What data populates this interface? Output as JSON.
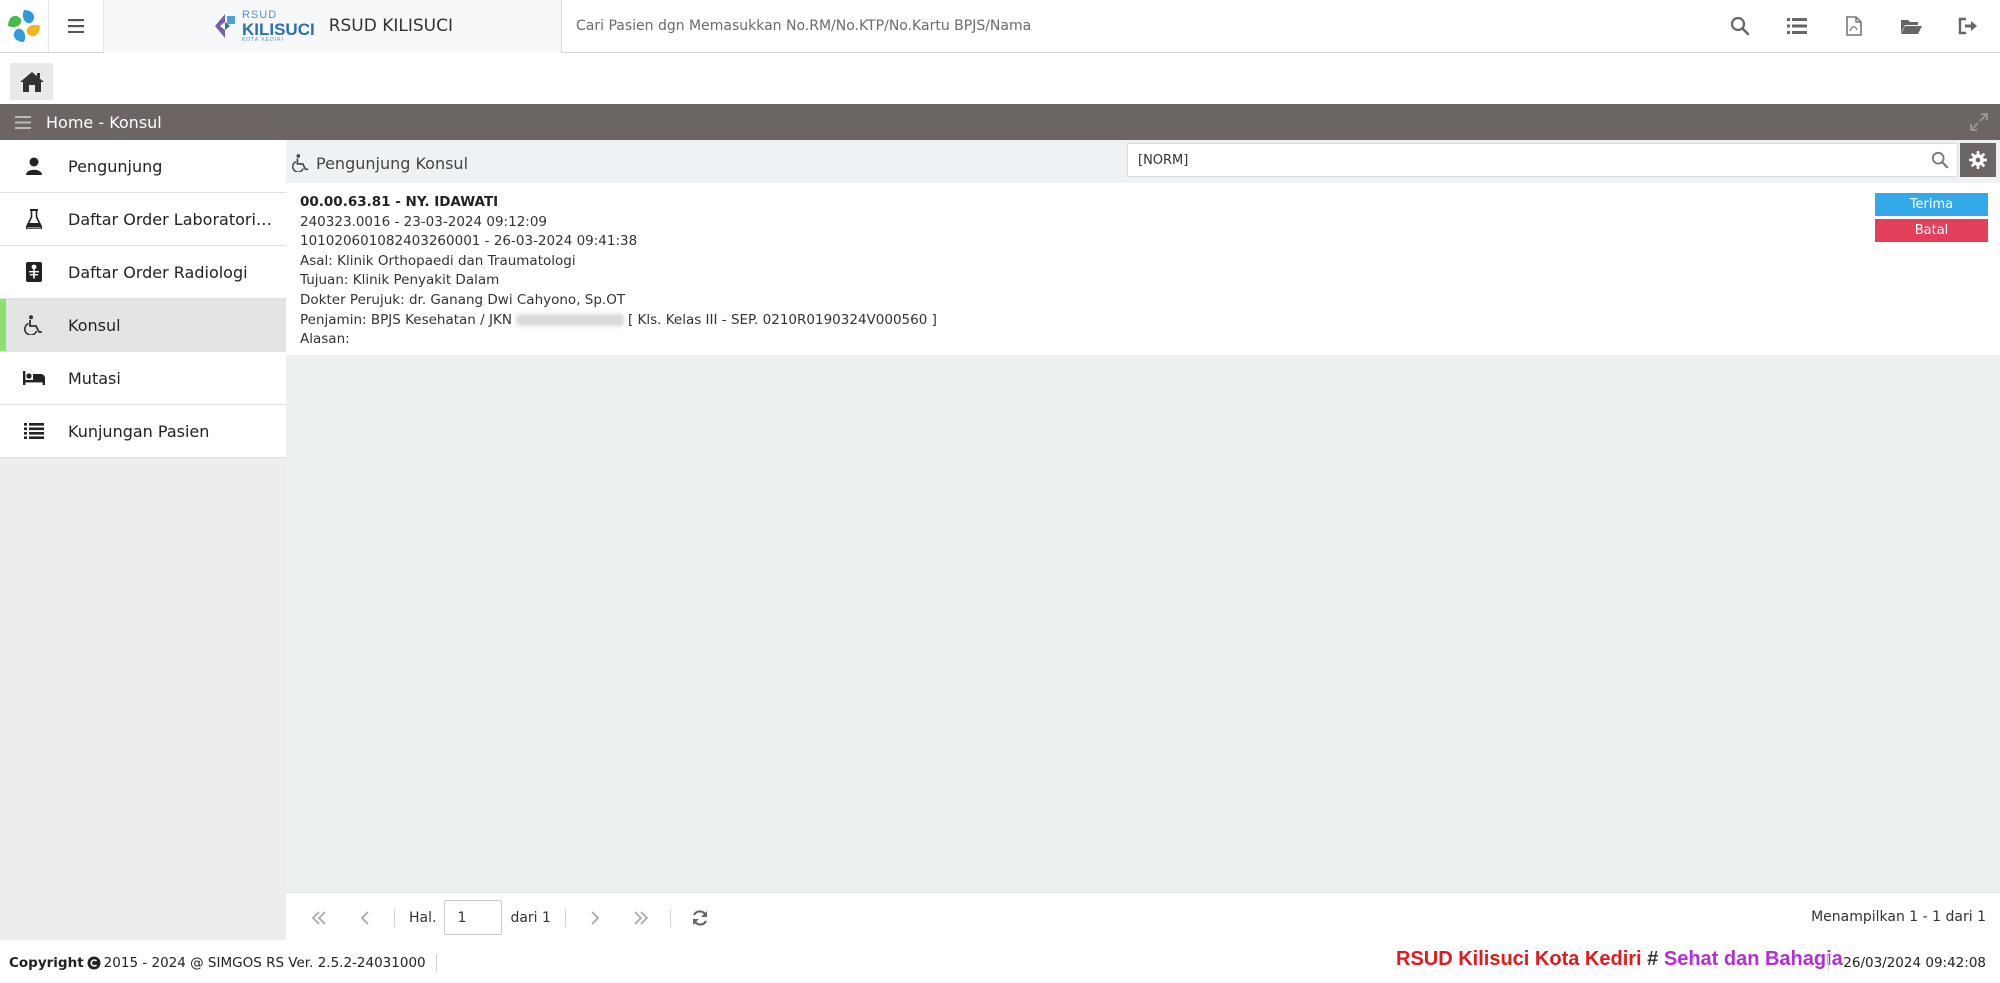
{
  "header": {
    "brand_logo_small": "RSUD",
    "brand_logo_big": "KILISUCI",
    "brand_logo_tiny": "KOTA KEDIRI",
    "brand_name": "RSUD KILISUCI",
    "search_placeholder": "Cari Pasien dgn Memasukkan No.RM/No.KTP/No.Kartu BPJS/Nama",
    "icons": [
      "search-icon",
      "list-icon",
      "pdf-file-icon",
      "folder-open-icon",
      "sign-out-icon"
    ]
  },
  "breadcrumb": {
    "text": "Home - Konsul"
  },
  "sidebar": {
    "items": [
      {
        "label": "Pengunjung",
        "icon": "user-icon",
        "active": false
      },
      {
        "label": "Daftar Order Laboratorium",
        "icon": "flask-icon",
        "active": false
      },
      {
        "label": "Daftar Order Radiologi",
        "icon": "radiology-icon",
        "active": false
      },
      {
        "label": "Konsul",
        "icon": "wheelchair-icon",
        "active": true
      },
      {
        "label": "Mutasi",
        "icon": "bed-icon",
        "active": false
      },
      {
        "label": "Kunjungan Pasien",
        "icon": "list-icon",
        "active": false
      }
    ]
  },
  "panel": {
    "title": "Pengunjung Konsul",
    "search_value": "[NORM]"
  },
  "record": {
    "patient": "00.00.63.81 - NY. IDAWATI",
    "visit": "240323.0016 - 23-03-2024 09:12:09",
    "registration": "101020601082403260001 - 26-03-2024 09:41:38",
    "asal": "Asal: Klinik Orthopaedi dan Traumatologi",
    "tujuan": "Tujuan: Klinik Penyakit Dalam",
    "dokter": "Dokter Perujuk: dr. Ganang Dwi Cahyono, Sp.OT",
    "penjamin_prefix": "Penjamin: BPJS Kesehatan / JKN",
    "penjamin_suffix": "[ Kls. Kelas III - SEP. 0210R0190324V000560 ]",
    "alasan": "Alasan:",
    "btn_terima": "Terima",
    "btn_batal": "Batal"
  },
  "pager": {
    "hal_label": "Hal.",
    "page_value": "1",
    "of_label": "dari 1",
    "info": "Menampilkan 1 - 1 dari 1"
  },
  "footer": {
    "copyright_label": "Copyright",
    "copyright_text": "2015 - 2024 @ SIMGOS RS Ver. 2.5.2-24031000",
    "marquee_red": "RSUD Kilisuci Kota Kediri",
    "marquee_hash": "#",
    "marquee_purple": "Sehat dan Bahagia",
    "datetime": "26/03/2024 09:42:08"
  },
  "colors": {
    "crumb_bar": "#6b6663",
    "active_marker": "#8ee070",
    "terima": "#33a9e8",
    "batal": "#e3415b"
  }
}
